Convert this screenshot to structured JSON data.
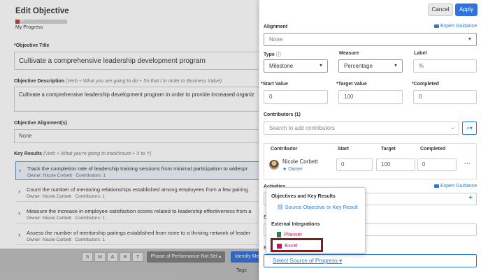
{
  "left": {
    "title": "Edit Objective",
    "progress": {
      "percent_text": "0%",
      "label": "My Progress",
      "fraction": 0.08
    },
    "objective_title_label": "*Objective Title",
    "objective_title_value": "Cultivate a comprehensive leadership development program",
    "description_label": "Objective Description",
    "description_hint": "(Verb + What you are going to do + So that / In order to Business Value)",
    "description_value": "Cultivate a comprehensive leadership development program in order to provide increased organiz",
    "alignment_label": "Objective Alignment(s)",
    "alignment_value": "None",
    "key_results_label": "Key Results",
    "key_results_hint": "(Verb + What you're going to track/count + X to Y)",
    "key_results": [
      {
        "text": "Track the completion rate of leadership training sessions from minimal participation to widespr",
        "owner": "Owner: Nicole Corbett",
        "contributors": "Contributors: 1"
      },
      {
        "text": "Count the number of mentoring relationships established among employees from a few pairing",
        "owner": "Owner: Nicole Corbett",
        "contributors": "Contributors: 1"
      },
      {
        "text": "Measure the increase in employee satisfaction scores related to leadership effectiveness from a",
        "owner": "Owner: Nicole Corbett",
        "contributors": "Contributors: 1"
      },
      {
        "text": "Assess the number of mentorship pairings established from none to a thriving network of leader",
        "owner": "Owner: Nicole Corbett",
        "contributors": "Contributors: 1"
      }
    ],
    "smart_letters": [
      "S",
      "M",
      "A",
      "R",
      "T"
    ],
    "phase_button": "Phase of Performance Not Set",
    "identify_button": "Identify Me",
    "tags_label": "Tags"
  },
  "right": {
    "cancel": "Cancel",
    "apply": "Apply",
    "alignment_label": "Alignment",
    "expert_guidance": "Expert Guidance",
    "alignment_value": "None",
    "type_label": "Type",
    "type_value": "Milestone",
    "measure_label": "Measure",
    "measure_value": "Percentage",
    "label_label": "Label",
    "label_value": "%",
    "start_label": "*Start Value",
    "start_value": "0",
    "target_label": "*Target Value",
    "target_value": "100",
    "completed_label": "*Completed",
    "completed_value": "0",
    "contributors_label": "Contributors (1)",
    "contributors_placeholder": "Search to add contributors",
    "table_headers": {
      "contributor": "Contributor",
      "start": "Start",
      "target": "Target",
      "completed": "Completed"
    },
    "contributor": {
      "name": "Nicole Corbett",
      "role": "Owner",
      "start": "0",
      "target": "100",
      "completed": "0"
    },
    "activities_label": "Activities",
    "status_label": "Sta",
    "source_label": "So",
    "popup": {
      "section1": "Objectives and Key Results",
      "source_okr": "Source Objective or Key Result",
      "section2": "External Integrations",
      "planner": "Planner",
      "excel": "Excel"
    },
    "source_select": "Select Source of Progress",
    "colors": {
      "accent": "#2d74e0",
      "link": "#2a7ae2",
      "highlight": "#7a1f1f",
      "excel": "#c2185b"
    }
  }
}
